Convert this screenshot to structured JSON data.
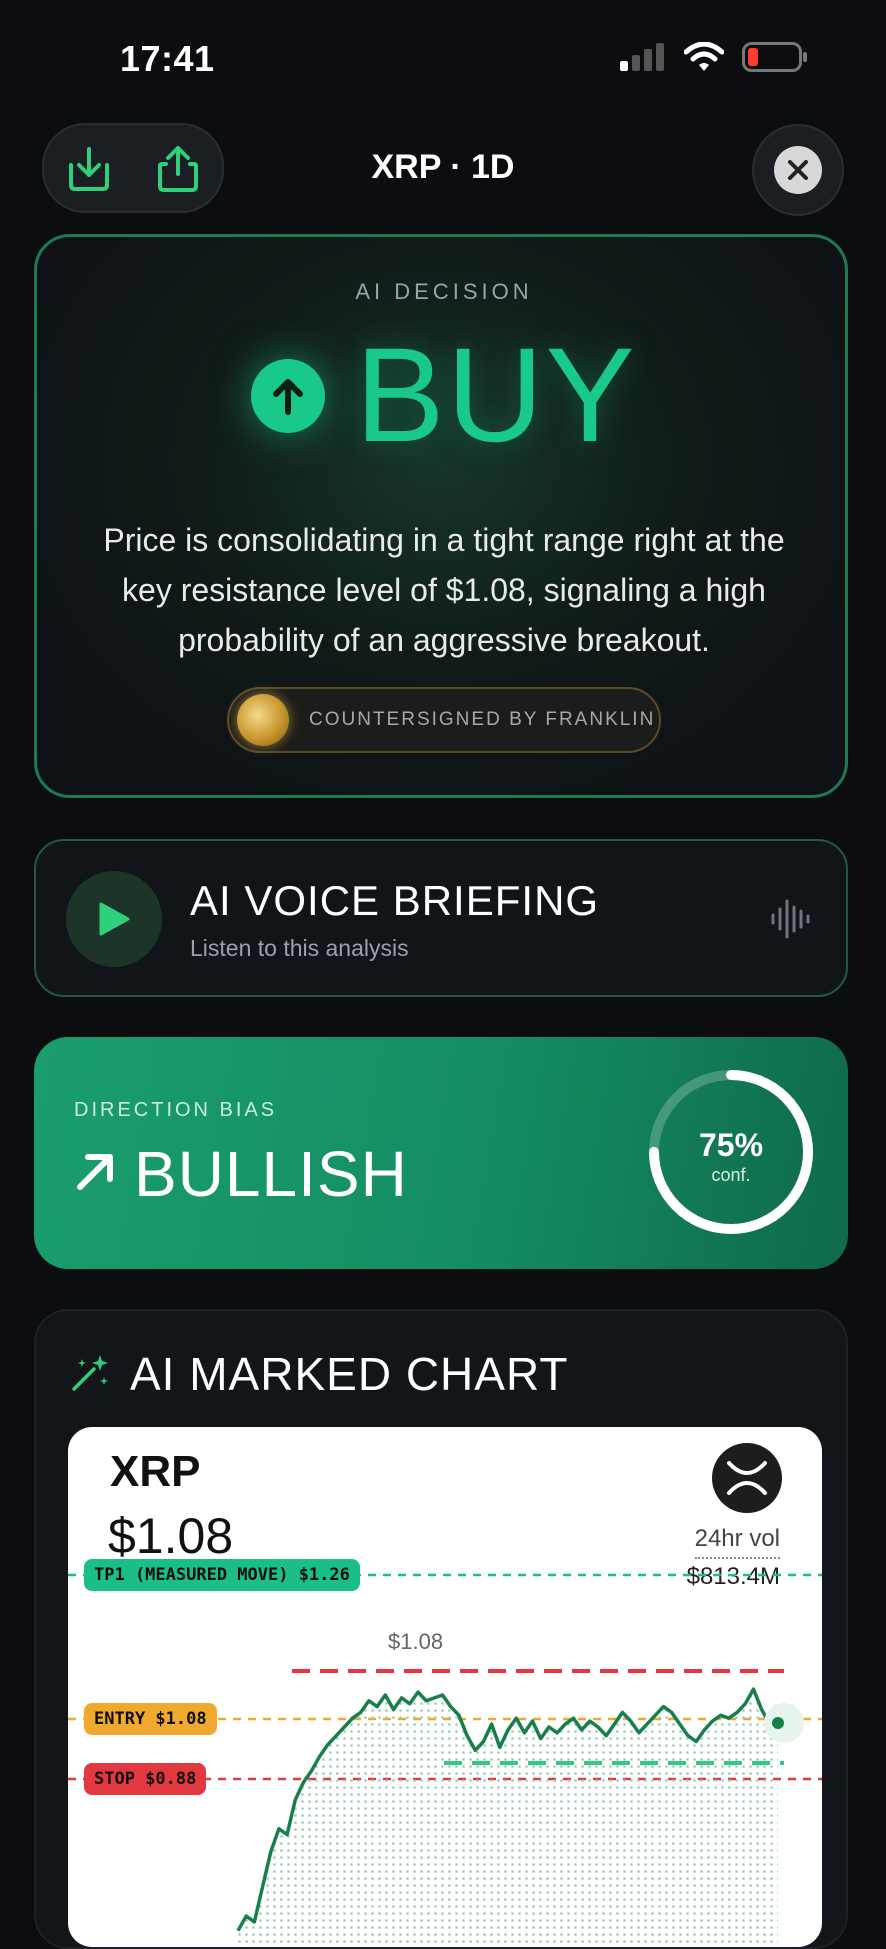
{
  "status_bar": {
    "time": "17:41"
  },
  "header": {
    "title": "XRP · 1D"
  },
  "decision": {
    "label": "AI DECISION",
    "action": "BUY",
    "description": "Price is consolidating in a tight range right at the key resistance level of $1.08, signaling a high probability of an aggressive breakout.",
    "countersign": "COUNTERSIGNED BY FRANKLIN"
  },
  "voice": {
    "title": "AI VOICE BRIEFING",
    "subtitle": "Listen to this analysis"
  },
  "bias": {
    "label": "DIRECTION BIAS",
    "value": "BULLISH",
    "confidence_text": "75%",
    "confidence_value": 0.75,
    "conf_label": "conf."
  },
  "chart_card": {
    "title": "AI MARKED CHART",
    "symbol": "XRP",
    "price": "$1.08",
    "vol_label": "24hr vol",
    "vol_value": "$813.4M",
    "peak_label": "$1.08",
    "tags": {
      "tp1": "TP1 (MEASURED MOVE) $1.26",
      "entry": "ENTRY $1.08",
      "stop": "STOP $0.88"
    }
  },
  "colors": {
    "accent_green": "#19c98a",
    "line_green": "#177f4a",
    "resistance_red": "#e2383f",
    "entry_amber": "#f0a92e",
    "tp_teal": "#1bbf86"
  },
  "chart_data": {
    "type": "line",
    "levels": {
      "tp1": 1.26,
      "entry": 1.08,
      "stop": 0.88
    },
    "values": [
      0.35,
      0.4,
      0.38,
      0.5,
      0.62,
      0.7,
      0.68,
      0.8,
      0.86,
      0.9,
      0.95,
      0.99,
      1.02,
      1.05,
      1.08,
      1.1,
      1.14,
      1.12,
      1.16,
      1.11,
      1.15,
      1.13,
      1.17,
      1.14,
      1.15,
      1.16,
      1.12,
      1.09,
      1.02,
      0.97,
      1.0,
      1.06,
      0.98,
      1.04,
      1.08,
      1.03,
      1.07,
      1.01,
      1.05,
      1.03,
      1.06,
      1.08,
      1.04,
      1.07,
      1.05,
      1.02,
      1.06,
      1.1,
      1.07,
      1.03,
      1.06,
      1.09,
      1.12,
      1.1,
      1.06,
      1.02,
      1.0,
      1.04,
      1.07,
      1.09,
      1.08,
      1.1,
      1.13,
      1.18,
      1.11,
      1.06,
      1.08
    ]
  }
}
